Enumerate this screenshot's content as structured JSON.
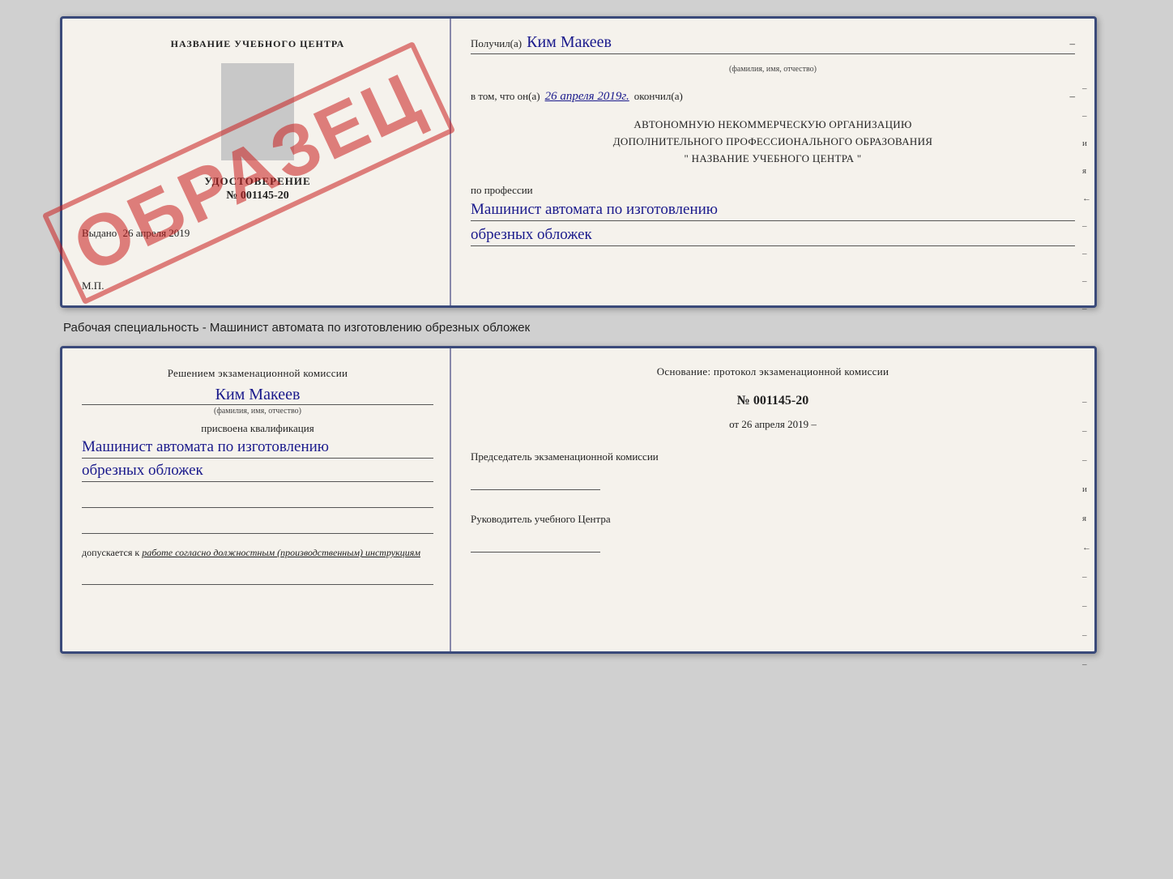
{
  "cert": {
    "left": {
      "title": "НАЗВАНИЕ УЧЕБНОГО ЦЕНТРА",
      "udost_label": "УДОСТОВЕРЕНИЕ",
      "udost_number": "№ 001145-20",
      "vydano": "Выдано",
      "vydano_date": "26 апреля 2019",
      "mp": "М.П."
    },
    "stamp": "ОБРАЗЕЦ",
    "right": {
      "poluchil": "Получил(а)",
      "name_cursive": "Ким Макеев",
      "fio_sub": "(фамилия, имя, отчество)",
      "dash1": "–",
      "vtom": "в том, что он(а)",
      "date_cursive": "26 апреля 2019г.",
      "okonchil": "окончил(а)",
      "dash2": "–",
      "org_line1": "АВТОНОМНУЮ НЕКОММЕРЧЕСКУЮ ОРГАНИЗАЦИЮ",
      "org_line2": "ДОПОЛНИТЕЛЬНОГО ПРОФЕССИОНАЛЬНОГО ОБРАЗОВАНИЯ",
      "org_line3": "\" НАЗВАНИЕ УЧЕБНОГО ЦЕНТРА \"",
      "po_professii": "по профессии",
      "profession1": "Машинист автомата по изготовлению",
      "profession2": "обрезных обложек",
      "side_marks": [
        "–",
        "–",
        "и",
        "я",
        "←",
        "–",
        "–",
        "–",
        "–"
      ]
    }
  },
  "specialty_label": "Рабочая специальность - Машинист автомата по изготовлению обрезных обложек",
  "qual": {
    "left": {
      "resheniyem": "Решением экзаменационной комиссии",
      "name_cursive": "Ким Макеев",
      "fio_sub": "(фамилия, имя, отчество)",
      "prisvoena": "присвоена квалификация",
      "profession1": "Машинист автомата по изготовлению",
      "profession2": "обрезных обложек",
      "dopuskaetsya": "допускается к",
      "dopusk_italic": "работе согласно должностным (производственным) инструкциям"
    },
    "right": {
      "osnovaniye": "Основание: протокол экзаменационной комиссии",
      "number": "№ 001145-20",
      "ot": "от",
      "ot_date": "26 апреля 2019",
      "predsedatel_label": "Председатель экзаменационной комиссии",
      "rukovoditel_label": "Руководитель учебного Центра",
      "side_marks": [
        "–",
        "–",
        "–",
        "и",
        "я",
        "←",
        "–",
        "–",
        "–",
        "–"
      ]
    }
  }
}
